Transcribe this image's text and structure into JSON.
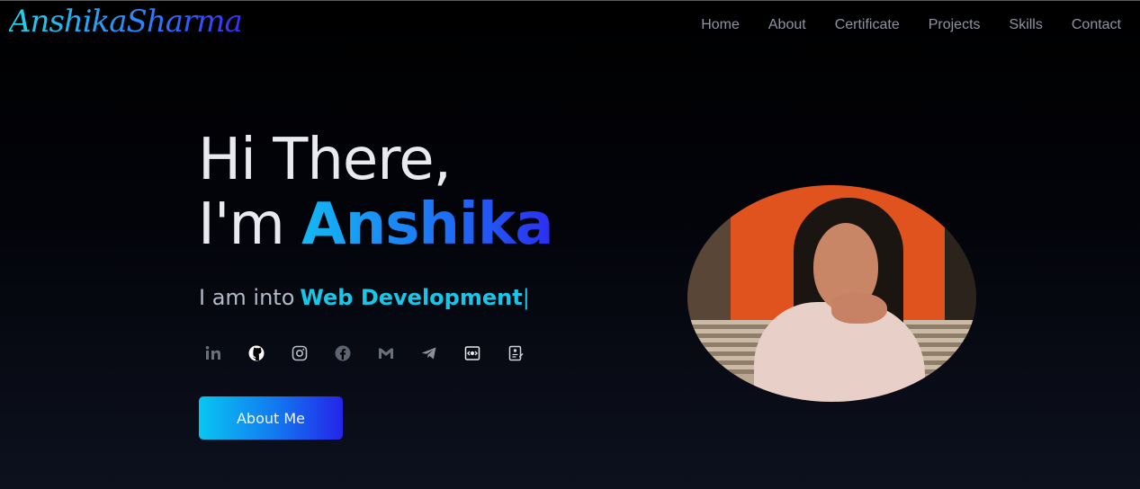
{
  "brand": {
    "logo_text": "AnshikaSharma"
  },
  "nav": {
    "items": [
      {
        "label": "Home"
      },
      {
        "label": "About"
      },
      {
        "label": "Certificate"
      },
      {
        "label": "Projects"
      },
      {
        "label": "Skills"
      },
      {
        "label": "Contact"
      }
    ]
  },
  "hero": {
    "greeting": "Hi There,",
    "intro": "I'm ",
    "name": "Anshika",
    "typing_prefix": "I am into",
    "typing_value": "Web Development",
    "typing_caret": "|",
    "cta_label": "About Me"
  },
  "socials": [
    {
      "icon": "linkedin-icon"
    },
    {
      "icon": "github-icon"
    },
    {
      "icon": "instagram-icon"
    },
    {
      "icon": "facebook-icon"
    },
    {
      "icon": "gmail-icon"
    },
    {
      "icon": "telegram-icon"
    },
    {
      "icon": "codepen-icon"
    },
    {
      "icon": "resume-icon"
    }
  ],
  "colors": {
    "accent_cyan": "#17c6e8",
    "accent_blue": "#1f6cf5",
    "accent_indigo": "#2c2df0",
    "nav_text": "#8e93a3",
    "background": "#000000"
  }
}
